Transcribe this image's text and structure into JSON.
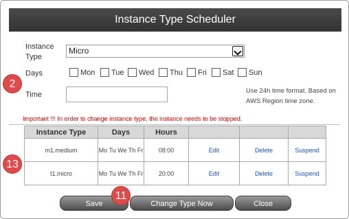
{
  "dialog": {
    "title": "Instance Type Scheduler"
  },
  "form": {
    "instance_type_label": "Instance Type",
    "instance_type_value": "Micro",
    "days_label": "Days",
    "days": [
      "Mon",
      "Tue",
      "Wed",
      "Thu",
      "Fri",
      "Sat",
      "Sun"
    ],
    "time_label": "Time",
    "time_value": "",
    "time_hint": "Use 24h time format. Based on AWS Region time zone."
  },
  "important_note": "Important !!! In order to change instance type, the instance needs to be stopped.",
  "table": {
    "headers": [
      "Instance Type",
      "Days",
      "Hours",
      "",
      "",
      ""
    ],
    "rows": [
      {
        "instance_type": "m1.medium",
        "days": "Mo Tu We Th Fr",
        "hours": "08:00",
        "edit": "Edit",
        "delete": "Delete",
        "suspend": "Suspend"
      },
      {
        "instance_type": "t1.micro",
        "days": "Mo Tu We Th Fr",
        "hours": "20:00",
        "edit": "Edit",
        "delete": "Delete",
        "suspend": "Suspend"
      }
    ]
  },
  "buttons": {
    "save": "Save",
    "change_type_now": "Change Type Now",
    "close": "Close"
  },
  "badges": {
    "days": "2",
    "table": "13",
    "buttons": "11"
  },
  "colors": {
    "title_bar": "#3a3a3a",
    "important": "#e00000",
    "link": "#1a56b8",
    "badge": "#e04a4a"
  }
}
